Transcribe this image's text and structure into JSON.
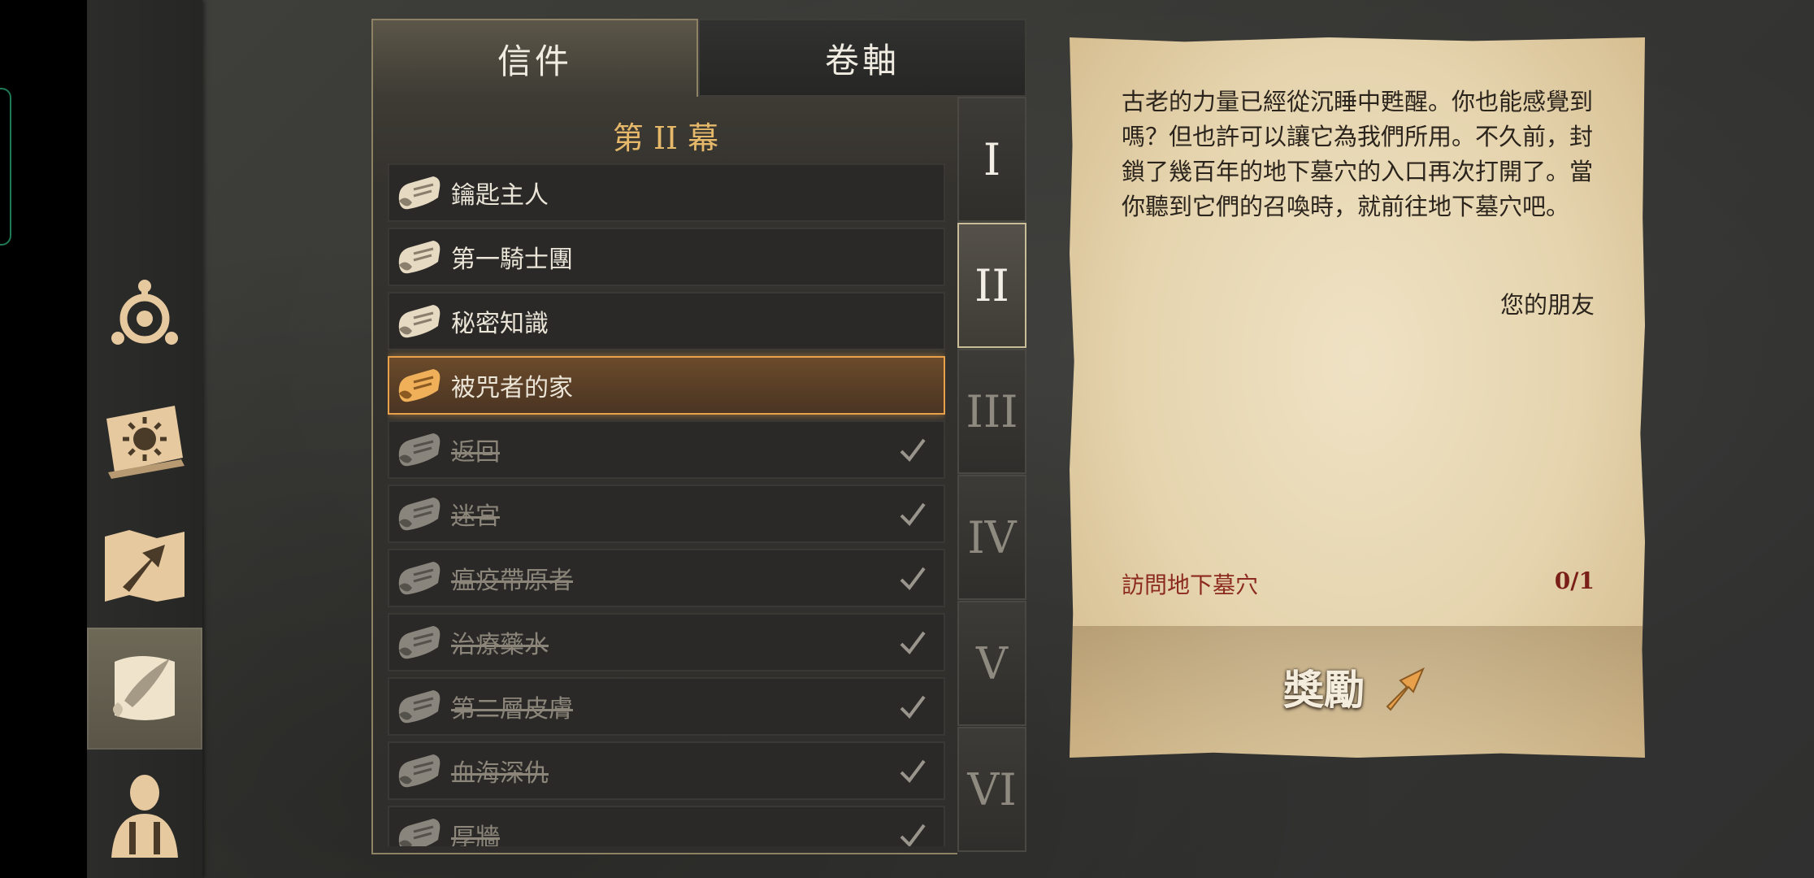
{
  "tabs": {
    "letters": "信件",
    "scrolls": "卷軸"
  },
  "act_title": "第 II 幕",
  "letters": [
    {
      "title": "鑰匙主人",
      "done": false,
      "selected": false
    },
    {
      "title": "第一騎士團",
      "done": false,
      "selected": false
    },
    {
      "title": "秘密知識",
      "done": false,
      "selected": false
    },
    {
      "title": "被咒者的家",
      "done": false,
      "selected": true
    },
    {
      "title": "返回",
      "done": true,
      "selected": false
    },
    {
      "title": "迷宮",
      "done": true,
      "selected": false
    },
    {
      "title": "瘟疫帶原者",
      "done": true,
      "selected": false
    },
    {
      "title": "治療藥水",
      "done": true,
      "selected": false
    },
    {
      "title": "第二層皮膚",
      "done": true,
      "selected": false
    },
    {
      "title": "血海深仇",
      "done": true,
      "selected": false
    },
    {
      "title": "厚牆",
      "done": true,
      "selected": false
    }
  ],
  "acts": [
    "I",
    "II",
    "III",
    "IV",
    "V",
    "VI"
  ],
  "current_act": "II",
  "letter": {
    "body": "古老的力量已經從沉睡中甦醒。你也能感覺到嗎？但也許可以讓它為我們所用。不久前，封鎖了幾百年的地下墓穴的入口再次打開了。當你聽到它們的召喚時，就前往地下墓穴吧。",
    "signature": "您的朋友",
    "objective": "訪問地下墓穴",
    "progress": "0/1",
    "reward_label": "獎勵"
  },
  "rail_icons": [
    "compass-icon",
    "sun-book-icon",
    "map-arrow-icon",
    "scroll-quill-icon",
    "hero-icon"
  ],
  "colors": {
    "accent": "#e8a04a",
    "parchment": "#e5d4ae",
    "objective": "#8c2a1f"
  }
}
